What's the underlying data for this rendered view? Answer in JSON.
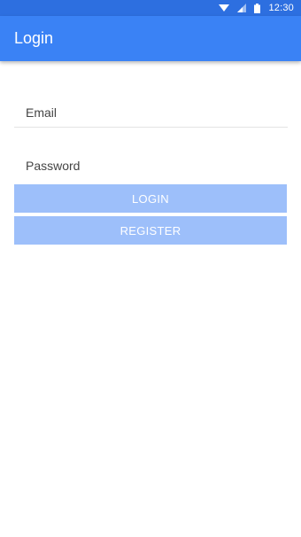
{
  "status_bar": {
    "time": "12:30",
    "icons": [
      "wifi-icon",
      "signal-icon",
      "battery-icon"
    ]
  },
  "app_bar": {
    "title": "Login",
    "color": "#3a82f5"
  },
  "form": {
    "email": {
      "placeholder": "Email",
      "value": ""
    },
    "password": {
      "placeholder": "Password",
      "value": ""
    },
    "login_label": "LOGIN",
    "register_label": "REGISTER",
    "button_color": "#9dbffa"
  }
}
